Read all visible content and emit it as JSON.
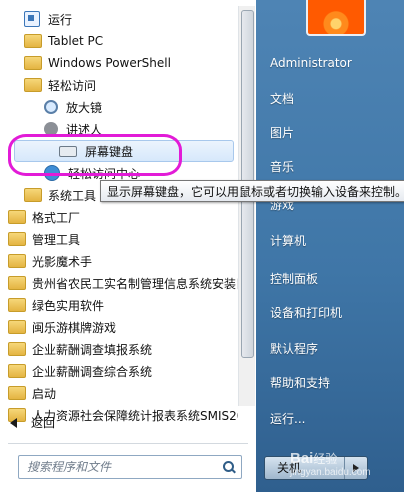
{
  "left_menu": {
    "items": [
      {
        "label": "运行",
        "type": "app",
        "icon": "run-icon",
        "indent": 1
      },
      {
        "label": "Tablet PC",
        "type": "folder",
        "icon": "folder-icon",
        "indent": 1
      },
      {
        "label": "Windows PowerShell",
        "type": "folder",
        "icon": "folder-icon",
        "indent": 1
      },
      {
        "label": "轻松访问",
        "type": "folder",
        "icon": "folder-icon",
        "indent": 1
      },
      {
        "label": "放大镜",
        "type": "app",
        "icon": "magnifier-icon",
        "indent": 2
      },
      {
        "label": "讲述人",
        "type": "app",
        "icon": "narrator-icon",
        "indent": 2
      },
      {
        "label": "屏幕键盘",
        "type": "app",
        "icon": "keyboard-icon",
        "indent": 2,
        "selected": true
      },
      {
        "label": "轻松访问中心",
        "type": "app",
        "icon": "ease-of-access-icon",
        "indent": 2
      },
      {
        "label": "系统工具",
        "type": "folder",
        "icon": "folder-icon",
        "indent": 1
      },
      {
        "label": "格式工厂",
        "type": "folder",
        "icon": "folder-icon",
        "indent": 0
      },
      {
        "label": "管理工具",
        "type": "folder",
        "icon": "folder-icon",
        "indent": 0
      },
      {
        "label": "光影魔术手",
        "type": "folder",
        "icon": "folder-icon",
        "indent": 0
      },
      {
        "label": "贵州省农民工实名制管理信息系统安装目",
        "type": "folder",
        "icon": "folder-icon",
        "indent": 0
      },
      {
        "label": "绿色实用软件",
        "type": "folder",
        "icon": "folder-icon",
        "indent": 0
      },
      {
        "label": "闽乐游棋牌游戏",
        "type": "folder",
        "icon": "folder-icon",
        "indent": 0
      },
      {
        "label": "企业薪酬调查填报系统",
        "type": "folder",
        "icon": "folder-icon",
        "indent": 0
      },
      {
        "label": "企业薪酬调查综合系统",
        "type": "folder",
        "icon": "folder-icon",
        "indent": 0
      },
      {
        "label": "启动",
        "type": "folder",
        "icon": "folder-icon",
        "indent": 0
      },
      {
        "label": "人力资源社会保障统计报表系统SMIS20",
        "type": "folder",
        "icon": "folder-icon",
        "indent": 0
      }
    ],
    "back_label": "返回",
    "search_placeholder": "搜索程序和文件"
  },
  "tooltip": "显示屏幕键盘，它可以用鼠标或者切换输入设备来控制。",
  "right_menu": {
    "user": "Administrator",
    "items": [
      "文档",
      "图片",
      "音乐",
      "游戏",
      "计算机",
      "控制面板",
      "设备和打印机",
      "默认程序",
      "帮助和支持",
      "运行..."
    ],
    "shutdown_label": "关机"
  },
  "watermark": {
    "text": "Bai",
    "text2": "经验",
    "url": "jingyan.baidu.com"
  },
  "colors": {
    "highlight_ring": "#e21bd7",
    "right_pane": "#3f76a7"
  }
}
